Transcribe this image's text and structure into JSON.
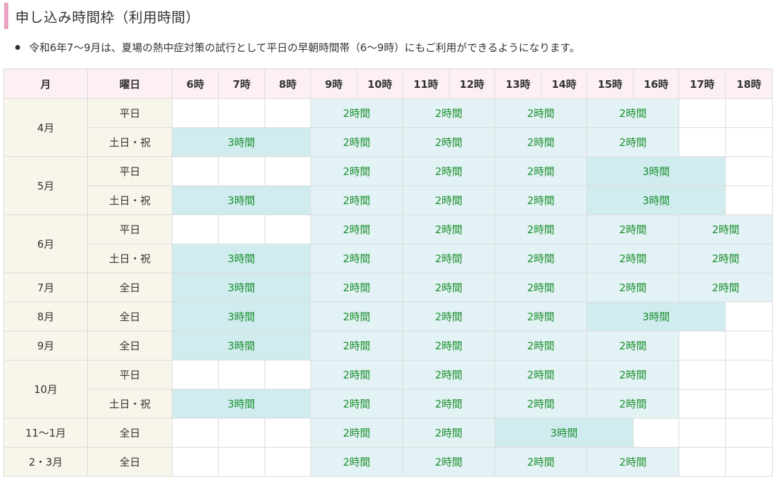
{
  "heading": "申し込み時間枠（利用時間）",
  "note": "令和6年7～9月は、夏場の熱中症対策の試行として平日の早朝時間帯（6～9時）にもご利用ができるようになります。",
  "colors": {
    "heading_bar": "#e9a3c0",
    "header_bg": "#fdf0f5",
    "label_bg": "#f8f5ea",
    "slot_2h_bg": "#e3f2f4",
    "slot_3h_bg": "#d0ecef",
    "slot_text": "#1a8f2e"
  },
  "table": {
    "headers": [
      "月",
      "曜日",
      "6時",
      "7時",
      "8時",
      "9時",
      "10時",
      "11時",
      "12時",
      "13時",
      "14時",
      "15時",
      "16時",
      "17時",
      "18時"
    ],
    "rows": [
      {
        "month": "4月",
        "day": "平日",
        "cells": [
          {
            "span": 1,
            "text": ""
          },
          {
            "span": 1,
            "text": ""
          },
          {
            "span": 1,
            "text": ""
          },
          {
            "span": 2,
            "text": "2時間"
          },
          {
            "span": 2,
            "text": "2時間"
          },
          {
            "span": 2,
            "text": "2時間"
          },
          {
            "span": 2,
            "text": "2時間"
          },
          {
            "span": 1,
            "text": ""
          },
          {
            "span": 1,
            "text": ""
          }
        ]
      },
      {
        "month": "",
        "day": "土日・祝",
        "cells": [
          {
            "span": 3,
            "text": "3時間"
          },
          {
            "span": 2,
            "text": "2時間"
          },
          {
            "span": 2,
            "text": "2時間"
          },
          {
            "span": 2,
            "text": "2時間"
          },
          {
            "span": 2,
            "text": "2時間"
          },
          {
            "span": 1,
            "text": ""
          },
          {
            "span": 1,
            "text": ""
          }
        ]
      },
      {
        "month": "5月",
        "day": "平日",
        "cells": [
          {
            "span": 1,
            "text": ""
          },
          {
            "span": 1,
            "text": ""
          },
          {
            "span": 1,
            "text": ""
          },
          {
            "span": 2,
            "text": "2時間"
          },
          {
            "span": 2,
            "text": "2時間"
          },
          {
            "span": 2,
            "text": "2時間"
          },
          {
            "span": 3,
            "text": "3時間"
          },
          {
            "span": 1,
            "text": ""
          }
        ]
      },
      {
        "month": "",
        "day": "土日・祝",
        "cells": [
          {
            "span": 3,
            "text": "3時間"
          },
          {
            "span": 2,
            "text": "2時間"
          },
          {
            "span": 2,
            "text": "2時間"
          },
          {
            "span": 2,
            "text": "2時間"
          },
          {
            "span": 3,
            "text": "3時間"
          },
          {
            "span": 1,
            "text": ""
          }
        ]
      },
      {
        "month": "6月",
        "day": "平日",
        "cells": [
          {
            "span": 1,
            "text": ""
          },
          {
            "span": 1,
            "text": ""
          },
          {
            "span": 1,
            "text": ""
          },
          {
            "span": 2,
            "text": "2時間"
          },
          {
            "span": 2,
            "text": "2時間"
          },
          {
            "span": 2,
            "text": "2時間"
          },
          {
            "span": 2,
            "text": "2時間"
          },
          {
            "span": 2,
            "text": "2時間"
          }
        ]
      },
      {
        "month": "",
        "day": "土日・祝",
        "cells": [
          {
            "span": 3,
            "text": "3時間"
          },
          {
            "span": 2,
            "text": "2時間"
          },
          {
            "span": 2,
            "text": "2時間"
          },
          {
            "span": 2,
            "text": "2時間"
          },
          {
            "span": 2,
            "text": "2時間"
          },
          {
            "span": 2,
            "text": "2時間"
          }
        ]
      },
      {
        "month": "7月",
        "day": "全日",
        "cells": [
          {
            "span": 3,
            "text": "3時間"
          },
          {
            "span": 2,
            "text": "2時間"
          },
          {
            "span": 2,
            "text": "2時間"
          },
          {
            "span": 2,
            "text": "2時間"
          },
          {
            "span": 2,
            "text": "2時間"
          },
          {
            "span": 2,
            "text": "2時間"
          }
        ]
      },
      {
        "month": "8月",
        "day": "全日",
        "cells": [
          {
            "span": 3,
            "text": "3時間"
          },
          {
            "span": 2,
            "text": "2時間"
          },
          {
            "span": 2,
            "text": "2時間"
          },
          {
            "span": 2,
            "text": "2時間"
          },
          {
            "span": 3,
            "text": "3時間"
          },
          {
            "span": 1,
            "text": ""
          }
        ]
      },
      {
        "month": "9月",
        "day": "全日",
        "cells": [
          {
            "span": 3,
            "text": "3時間"
          },
          {
            "span": 2,
            "text": "2時間"
          },
          {
            "span": 2,
            "text": "2時間"
          },
          {
            "span": 2,
            "text": "2時間"
          },
          {
            "span": 2,
            "text": "2時間"
          },
          {
            "span": 1,
            "text": ""
          },
          {
            "span": 1,
            "text": ""
          }
        ]
      },
      {
        "month": "10月",
        "day": "平日",
        "cells": [
          {
            "span": 1,
            "text": ""
          },
          {
            "span": 1,
            "text": ""
          },
          {
            "span": 1,
            "text": ""
          },
          {
            "span": 2,
            "text": "2時間"
          },
          {
            "span": 2,
            "text": "2時間"
          },
          {
            "span": 2,
            "text": "2時間"
          },
          {
            "span": 2,
            "text": "2時間"
          },
          {
            "span": 1,
            "text": ""
          },
          {
            "span": 1,
            "text": ""
          }
        ]
      },
      {
        "month": "",
        "day": "土日・祝",
        "cells": [
          {
            "span": 3,
            "text": "3時間"
          },
          {
            "span": 2,
            "text": "2時間"
          },
          {
            "span": 2,
            "text": "2時間"
          },
          {
            "span": 2,
            "text": "2時間"
          },
          {
            "span": 2,
            "text": "2時間"
          },
          {
            "span": 1,
            "text": ""
          },
          {
            "span": 1,
            "text": ""
          }
        ]
      },
      {
        "month": "11～1月",
        "day": "全日",
        "cells": [
          {
            "span": 1,
            "text": ""
          },
          {
            "span": 1,
            "text": ""
          },
          {
            "span": 1,
            "text": ""
          },
          {
            "span": 2,
            "text": "2時間"
          },
          {
            "span": 2,
            "text": "2時間"
          },
          {
            "span": 3,
            "text": "3時間"
          },
          {
            "span": 1,
            "text": ""
          },
          {
            "span": 1,
            "text": ""
          },
          {
            "span": 1,
            "text": ""
          }
        ]
      },
      {
        "month": "2・3月",
        "day": "全日",
        "cells": [
          {
            "span": 1,
            "text": ""
          },
          {
            "span": 1,
            "text": ""
          },
          {
            "span": 1,
            "text": ""
          },
          {
            "span": 2,
            "text": "2時間"
          },
          {
            "span": 2,
            "text": "2時間"
          },
          {
            "span": 2,
            "text": "2時間"
          },
          {
            "span": 2,
            "text": "2時間"
          },
          {
            "span": 1,
            "text": ""
          },
          {
            "span": 1,
            "text": ""
          }
        ]
      }
    ]
  }
}
